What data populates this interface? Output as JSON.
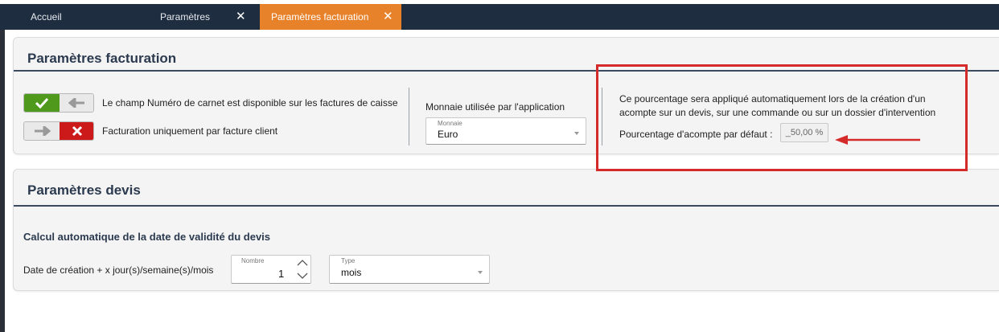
{
  "tabs": {
    "accueil": "Accueil",
    "parametres": "Paramètres",
    "parametres_facturation": "Paramètres facturation",
    "close_glyph": "✕"
  },
  "facturation": {
    "title": "Paramètres facturation",
    "option_carnet": "Le champ Numéro de carnet est disponible sur les factures de caisse",
    "option_facture_client": "Facturation uniquement par facture client",
    "monnaie_label": "Monnaie utilisée par l'application",
    "monnaie_caption": "Monnaie",
    "monnaie_value": "Euro",
    "acompte_description_line1": "Ce pourcentage sera appliqué automatiquement lors de la création d'un",
    "acompte_description_line2": "acompte sur un devis, sur une commande ou sur un dossier d'intervention",
    "acompte_label": "Pourcentage d'acompte par défaut :",
    "acompte_value": "_50,00 %"
  },
  "devis": {
    "title": "Paramètres devis",
    "subtitle": "Calcul automatique de la date de validité du devis",
    "date_label": "Date de création + x jour(s)/semaine(s)/mois",
    "nombre_caption": "Nombre",
    "nombre_value": "1",
    "type_caption": "Type",
    "type_value": "mois"
  },
  "colors": {
    "tabbar": "#1e2d40",
    "active_tab": "#e8822a",
    "toggle_on": "#4f9a1d",
    "toggle_off": "#cc1a1a",
    "annotation": "#d42a2a"
  },
  "icons": {
    "toggle_on": [
      "check-icon",
      "arrow-left-icon"
    ],
    "toggle_off": [
      "arrow-right-icon",
      "x-mark-icon"
    ],
    "annotation": "red-arrow"
  }
}
